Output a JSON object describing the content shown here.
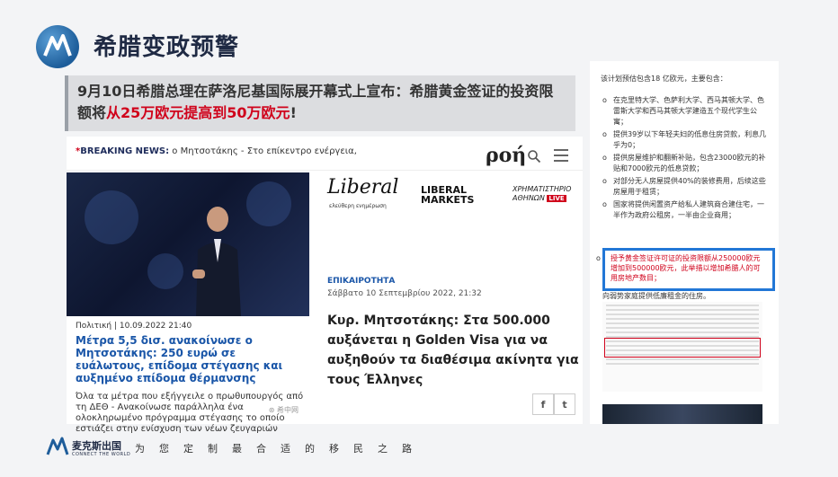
{
  "slide": {
    "title": "希腊变政预警",
    "headline": {
      "part1": "9月10日希腊总理在萨洛尼基国际展开幕式上宣布：希腊黄金签证的投资限额将",
      "highlight": "从25万欧元提高到50万欧元",
      "end": "!"
    }
  },
  "news_site": {
    "breaking_star": "*",
    "breaking_label": "BREAKING NEWS:",
    "breaking_text": " ο Μητσοτάκης - Στο επίκεντρο ενέργεια,",
    "logo": "ροή",
    "card": {
      "meta": "Πολιτική | 10.09.2022 21:40",
      "title": "Μέτρα 5,5 δισ. ανακοίνωσε ο Μητσοτάκης: 250 ευρώ σε ευάλωτους, επίδομα στέγασης και αυξημένο επίδομα θέρμανσης",
      "desc": "Όλα τα μέτρα που εξήγγειλε ο πρωθυπουργός από τη ΔΕΘ - Ανακοίνωσε παράλληλα ένα ολοκληρωμένο πρόγραμμα στέγασης το οποίο εστιάζει στην ενίσχυση των νέων ζευγαριών",
      "watermark": "⊛ 希中网"
    },
    "logos": {
      "liberal": "Liberal",
      "liberal_sub": "ελεύθερη ενημέρωση",
      "markets_line1": "LIBERAL",
      "markets_line2": "MARKETS",
      "xa_line1": "ΧΡΗΜΑΤΙΣΤΗΡΙΟ",
      "xa_line2": "ΑΘΗΝΩΝ",
      "xa_live": "LIVE"
    },
    "article": {
      "category": "ΕΠΙΚΑΙΡΟΤΗΤΑ",
      "date": "Σάββατο 10 Σεπτεμβρίου 2022, 21:32",
      "title": "Κυρ. Μητσοτάκης: Στα 500.000 αυξάνεται η Golden Visa για να αυξηθούν τα διαθέσιμα ακίνητα για τους Έλληνες"
    },
    "share": {
      "facebook": "f",
      "twitter": "t"
    }
  },
  "doc": {
    "intro": "该计划预估包含18 亿欧元，主要包含：",
    "items": [
      "在克里特大学、色萨利大学、西马其顿大学、色雷斯大学和西马其顿大学建造五个现代学生公寓；",
      "提供39岁以下年轻夫妇的低息住房贷款，利息几乎为0；",
      "提供房屋维护和翻新补贴，包含23000欧元的补贴和7000欧元的低息贷款；",
      "对部分无人房屋提供40%的装修费用，后续这些房屋用于租赁；",
      "国家将提供闲置资产给私人建筑商合建住宅，一半作为政府公租房，一半由企业商用；"
    ],
    "highlight": "授予黄金签证许可证的投资限额从250000欧元增加到500000欧元，此举措以增加希腊人的可用房地产数目；",
    "last": "向弱势家庭提供低廉租金的住房。"
  },
  "footer": {
    "brand": "麦克斯出国",
    "sub": "CONNECT THE WORLD",
    "slogan": "为您定制最合适的移民之路"
  },
  "colors": {
    "accent_red": "#d0021b",
    "accent_blue": "#2277d6",
    "link_blue": "#1a56a8"
  }
}
